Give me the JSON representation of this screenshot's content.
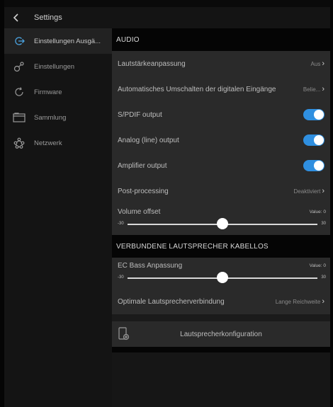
{
  "topbar": {
    "title": "Settings",
    "back_icon": "chevron-left-icon"
  },
  "sidebar": {
    "items": [
      {
        "label": "Einstellungen Ausgä...",
        "icon": "output-power-icon",
        "active": true
      },
      {
        "label": "Einstellungen",
        "icon": "settings-nodes-icon",
        "active": false
      },
      {
        "label": "Firmware",
        "icon": "refresh-icon",
        "active": false
      },
      {
        "label": "Sammlung",
        "icon": "folder-icon",
        "active": false
      },
      {
        "label": "Netzwerk",
        "icon": "network-icon",
        "active": false
      }
    ]
  },
  "audio": {
    "header": "AUDIO",
    "volume_adjust": {
      "label": "Lautstärkeanpassung",
      "value": "Aus"
    },
    "auto_switch": {
      "label": "Automatisches Umschalten der digitalen Eingänge",
      "value": "Belie..."
    },
    "spdif": {
      "label": "S/PDIF output",
      "on": true
    },
    "analog": {
      "label": "Analog (line) output",
      "on": true
    },
    "amplifier": {
      "label": "Amplifier output",
      "on": true
    },
    "post_processing": {
      "label": "Post-processing",
      "value": "Deaktiviert"
    },
    "volume_offset": {
      "label": "Volume offset",
      "value_text": "Value: 0",
      "min": "-30",
      "max": "30",
      "value": 0,
      "min_value": -30,
      "max_value": 30
    }
  },
  "wireless": {
    "header": "VERBUNDENE LAUTSPRECHER KABELLOS",
    "ec_bass": {
      "label": "EC Bass Anpassung",
      "value_text": "Value: 0",
      "min": "-30",
      "max": "30",
      "value": 0,
      "min_value": -30,
      "max_value": 30
    },
    "connection": {
      "label": "Optimale Lautsprecherverbindung",
      "value": "Lange Reichweite"
    }
  },
  "speaker_config": {
    "label": "Lautsprecherkonfiguration",
    "icon": "speaker-config-icon"
  },
  "colors": {
    "accent": "#2f8fe0",
    "background": "#141414",
    "row": "#2a2a2a"
  }
}
